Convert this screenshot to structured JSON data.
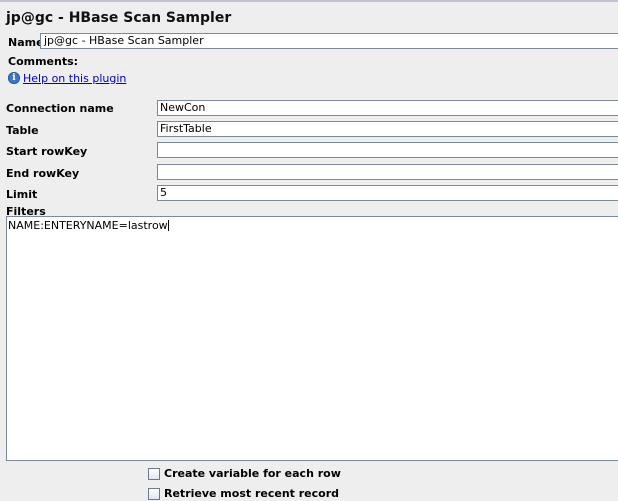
{
  "window": {
    "title": "jp@gc - HBase Scan Sampler"
  },
  "name_field": {
    "label": "Name:",
    "value": "jp@gc - HBase Scan Sampler"
  },
  "comments": {
    "label": "Comments:"
  },
  "help": {
    "icon": "info-icon",
    "link_text": "Help on this plugin"
  },
  "fields": {
    "connection_name": {
      "label": "Connection name",
      "value": "NewCon"
    },
    "table": {
      "label": "Table",
      "value": "FirstTable"
    },
    "start_rowkey": {
      "label": "Start rowKey",
      "value": ""
    },
    "end_rowkey": {
      "label": "End rowKey",
      "value": ""
    },
    "limit": {
      "label": "Limit",
      "value": "5"
    }
  },
  "filters": {
    "label": "Filters",
    "value": "NAME:ENTERYNAME=lastrow"
  },
  "options": {
    "create_variable": {
      "label": "Create variable for each row",
      "checked": false
    },
    "retrieve_recent": {
      "label": "Retrieve most recent record",
      "checked": false
    }
  }
}
